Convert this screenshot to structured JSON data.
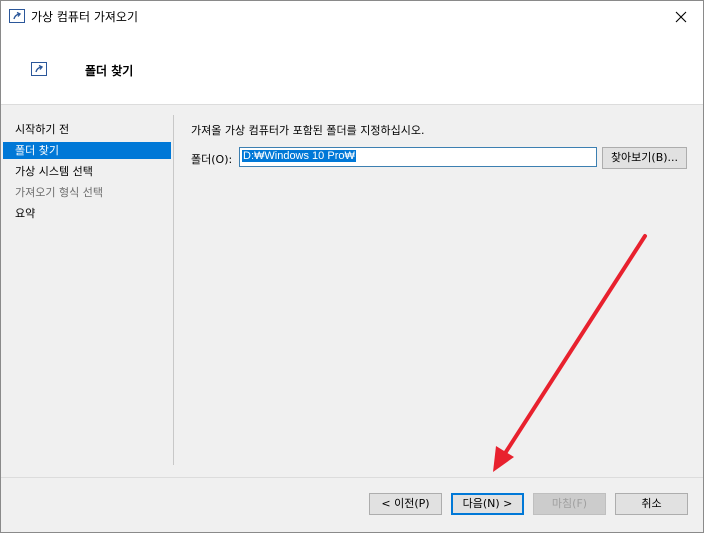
{
  "window": {
    "title": "가상 컴퓨터 가져오기"
  },
  "header": {
    "title": "폴더 찾기"
  },
  "nav": {
    "items": [
      {
        "label": "시작하기 전",
        "state": "normal"
      },
      {
        "label": "폴더 찾기",
        "state": "active"
      },
      {
        "label": "가상 시스템 선택",
        "state": "normal"
      },
      {
        "label": "가져오기 형식 선택",
        "state": "disabled"
      },
      {
        "label": "요약",
        "state": "normal"
      }
    ]
  },
  "main": {
    "instruction": "가져올 가상 컴퓨터가 포함된 폴더를 지정하십시오.",
    "folder_label": "폴더(O):",
    "folder_value": "D:₩Windows 10 Pro₩",
    "browse_label": "찾아보기(B)..."
  },
  "footer": {
    "prev_label": "< 이전(P)",
    "next_label": "다음(N) >",
    "finish_label": "마침(F)",
    "cancel_label": "취소"
  },
  "colors": {
    "accent": "#0078d7",
    "annotation_arrow": "#e8212e"
  },
  "icons": {
    "title": "import-vm-icon",
    "close": "close-icon",
    "annotation": "red-arrow-annotation"
  }
}
